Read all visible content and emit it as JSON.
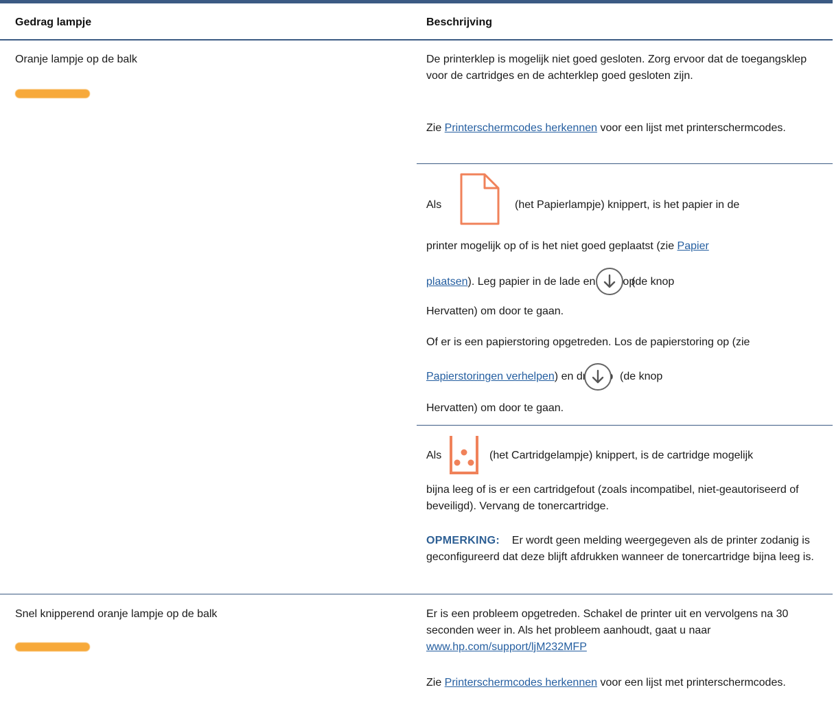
{
  "table": {
    "header": {
      "col1": "Gedrag lampje",
      "col2": "Beschrijving"
    },
    "rows": [
      {
        "behavior": "Oranje lampje op de balk",
        "light_color": "#f7a93a",
        "desc": {
          "p1": "De printerklep is mogelijk niet goed gesloten. Zorg ervoor dat de toegangsklep voor de cartridges en de achterklep goed gesloten zijn.",
          "p2_pre": "Zie ",
          "p2_link": "Printerschermcodes herkennen",
          "p2_post": " voor een lijst met printerschermcodes."
        }
      },
      {
        "desc": {
          "l1_pre": "Als",
          "icon": "paper-light-icon",
          "l1_post": "(het Papierlampje) knippert, is het papier in de",
          "l2_pre": "printer mogelijk op of is het niet goed geplaatst (zie ",
          "l2_link": "Papier",
          "l3_link": "plaatsen",
          "l3_post": "). Leg papier in de lade en druk op",
          "l3_after": "(de knop",
          "l4": "Hervatten) om door te gaan.",
          "l5": "Of er is een papierstoring opgetreden. Los de papierstoring op (zie",
          "l6_link": "Papierstoringen verhelpen",
          "l6_post": ") en druk op",
          "l6_after": "(de knop",
          "l7": "Hervatten) om door te gaan."
        }
      },
      {
        "desc": {
          "l1_pre": "Als",
          "icon": "cartridge-light-icon",
          "l1_post": "(het Cartridgelampje) knippert, is de cartridge mogelijk",
          "p2": "bijna leeg of is er een cartridgefout (zoals incompatibel, niet-geautoriseerd of beveiligd). Vervang de tonercartridge.",
          "note_label": "OPMERKING:",
          "note_text": "Er wordt geen melding weergegeven als de printer zodanig is geconfigureerd dat deze blijft afdrukken wanneer de tonercartridge bijna leeg is."
        }
      },
      {
        "behavior": "Snel knipperend oranje lampje op de balk",
        "light_color": "#f7a93a",
        "desc": {
          "p1_pre": "Er is een probleem opgetreden. Schakel de printer uit en vervolgens na 30 seconden weer in. Als het probleem aanhoudt, gaat u naar ",
          "p1_link": "www.hp.com/support/ljM232MFP",
          "p2_pre": "Zie ",
          "p2_link": "Printerschermcodes herkennen",
          "p2_post": " voor een lijst met printerschermcodes."
        }
      }
    ]
  },
  "icons": {
    "resume": "resume-button-icon",
    "paper": "paper-light-icon",
    "cartridge": "cartridge-light-icon"
  },
  "colors": {
    "rule": "#3b5a83",
    "link": "#245ea0",
    "icon_orange": "#f0825a",
    "note": "#2d5f94"
  }
}
